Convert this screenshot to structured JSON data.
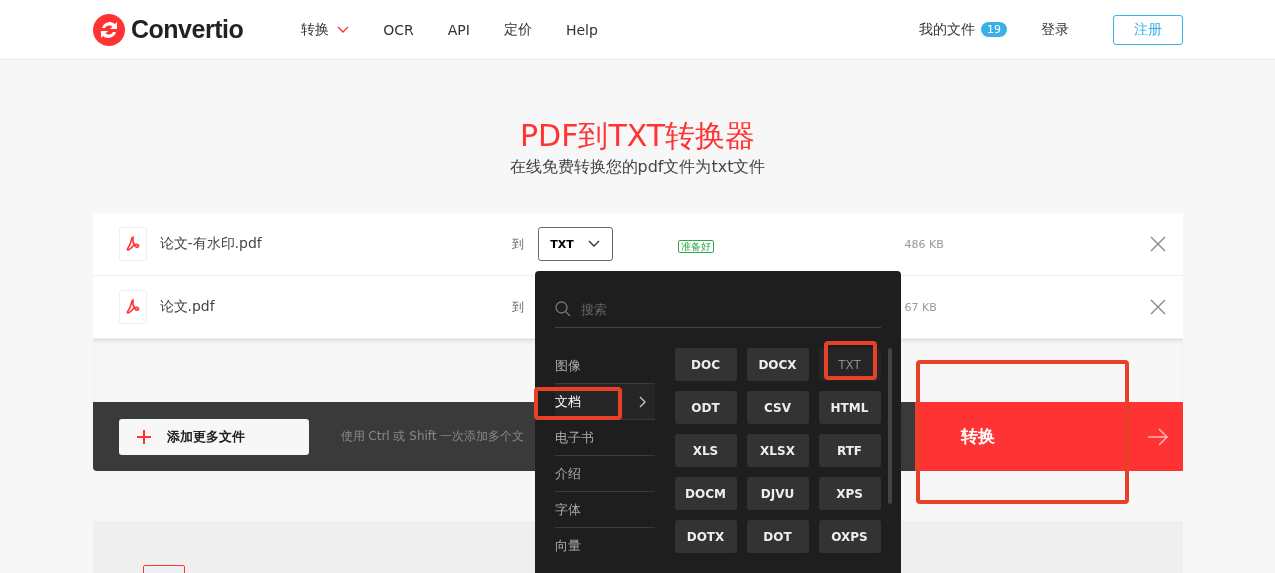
{
  "header": {
    "logo_text": "Convertio",
    "nav": [
      {
        "label": "转换",
        "dropdown": true
      },
      {
        "label": "OCR",
        "dropdown": false
      },
      {
        "label": "API",
        "dropdown": false
      },
      {
        "label": "定价",
        "dropdown": false
      },
      {
        "label": "Help",
        "dropdown": false
      }
    ],
    "my_files": {
      "label": "我的文件",
      "count": "19"
    },
    "login": "登录",
    "signup": "注册"
  },
  "hero": {
    "title": "PDF到TXT转换器",
    "subtitle": "在线免费转换您的pdf文件为txt文件"
  },
  "files": [
    {
      "name": "论文-有水印.pdf",
      "to_label": "到",
      "format": "TXT",
      "status": "准备好",
      "size": "486 KB"
    },
    {
      "name": "论文.pdf",
      "to_label": "到",
      "size": "67 KB"
    }
  ],
  "toolbar": {
    "add_button": "添加更多文件",
    "hint": "使用 Ctrl 或 Shift 一次添加多个文",
    "convert_button": "转换"
  },
  "format_menu": {
    "search_placeholder": "搜索",
    "categories": [
      {
        "label": "图像",
        "selected": false
      },
      {
        "label": "文档",
        "selected": true
      },
      {
        "label": "电子书",
        "selected": false
      },
      {
        "label": "介绍",
        "selected": false
      },
      {
        "label": "字体",
        "selected": false
      },
      {
        "label": "向量",
        "selected": false
      }
    ],
    "formats": [
      {
        "label": "DOC",
        "selected": false
      },
      {
        "label": "DOCX",
        "selected": false
      },
      {
        "label": "TXT",
        "selected": true
      },
      {
        "label": "ODT",
        "selected": false
      },
      {
        "label": "CSV",
        "selected": false
      },
      {
        "label": "HTML",
        "selected": false
      },
      {
        "label": "XLS",
        "selected": false
      },
      {
        "label": "XLSX",
        "selected": false
      },
      {
        "label": "RTF",
        "selected": false
      },
      {
        "label": "DOCM",
        "selected": false
      },
      {
        "label": "DJVU",
        "selected": false
      },
      {
        "label": "XPS",
        "selected": false
      },
      {
        "label": "DOTX",
        "selected": false
      },
      {
        "label": "DOT",
        "selected": false
      },
      {
        "label": "OXPS",
        "selected": false
      }
    ]
  }
}
